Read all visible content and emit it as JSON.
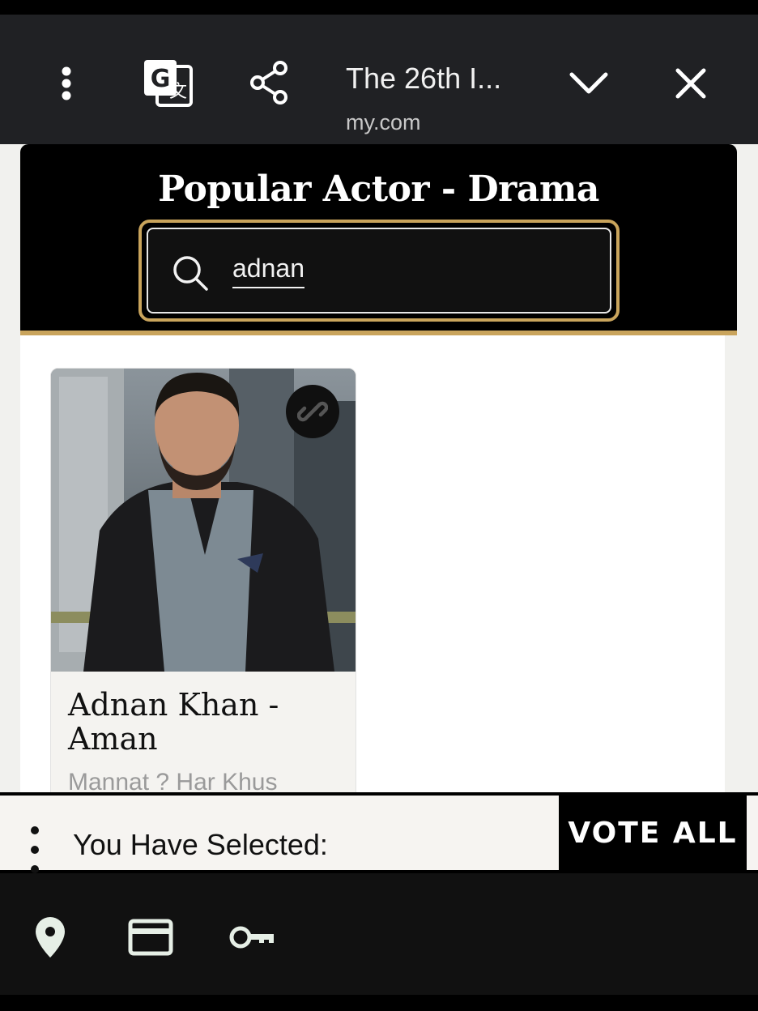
{
  "browser": {
    "title": "The 26th I...",
    "url": "my.com",
    "icons": [
      "more-vert-icon",
      "translate-icon",
      "share-icon",
      "chevron-down-icon",
      "close-icon"
    ]
  },
  "page": {
    "header_title": "Popular Actor - Drama",
    "search": {
      "value": "adnan"
    },
    "card": {
      "name": "Adnan Khan - Aman",
      "show": "Mannat ? Har Khus"
    }
  },
  "selection_bar": {
    "label": "You Have Selected:",
    "vote_all": "VOTE ALL"
  },
  "autofill_bar": {
    "icons": [
      "location-icon",
      "credit-card-icon",
      "key-icon"
    ]
  },
  "colors": {
    "gold": "#c9a45c",
    "toolbar": "#202124",
    "header": "#000000"
  }
}
